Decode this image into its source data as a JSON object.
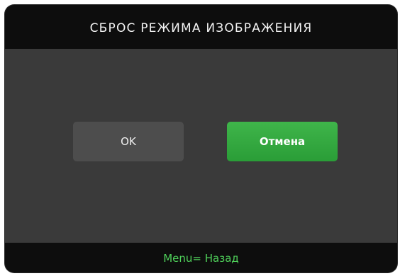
{
  "dialog": {
    "title": "СБРОС РЕЖИМА ИЗОБРАЖЕНИЯ",
    "buttons": {
      "ok_label": "OK",
      "cancel_label": "Отмена"
    },
    "footer_hint": "Menu= Назад"
  },
  "colors": {
    "dialog_background": "#3a3a3a",
    "bars_background": "#0d0d0d",
    "ok_button": "#4d4d4d",
    "cancel_button": "#2fa63c",
    "hint_text": "#4fd15a"
  }
}
